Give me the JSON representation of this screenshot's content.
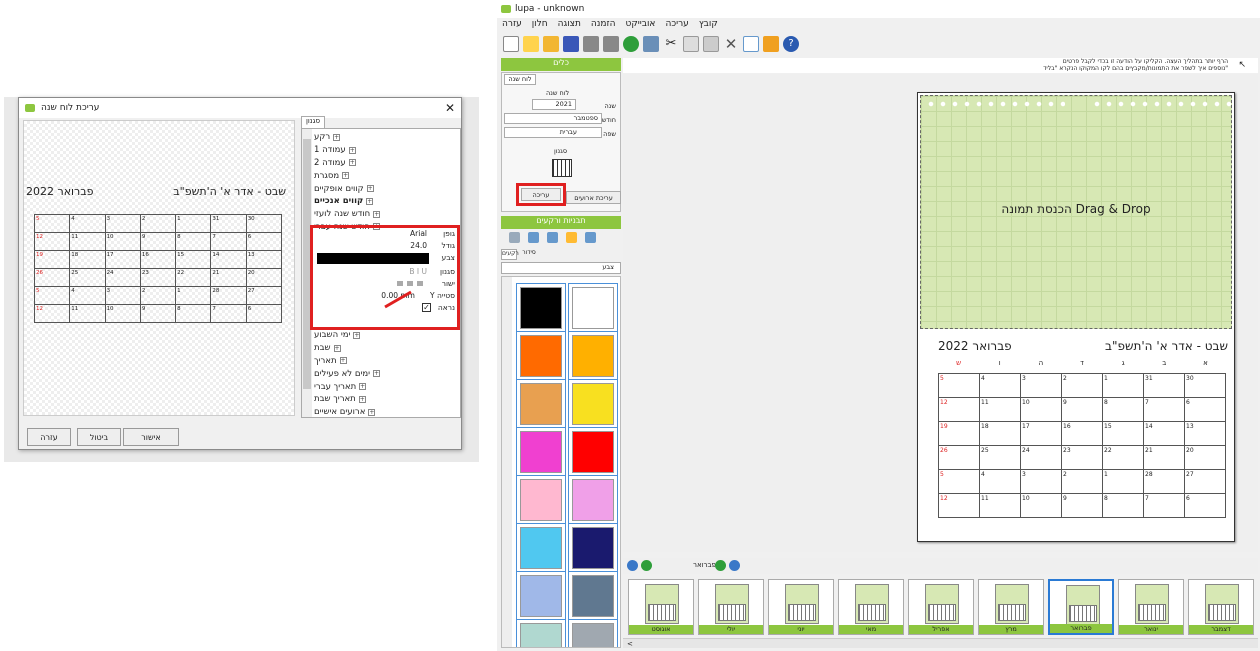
{
  "dialog": {
    "title": "עריכת לוח שנה",
    "tab": "סגנון",
    "preview_title_right": "שבט - אדר א' ה'תשפ\"ב",
    "preview_title_left": "פברואר 2022",
    "tree": [
      "רקע",
      "עמודה 1",
      "עמודה 2",
      "מסגרת",
      "קווים אופקיים",
      "קווים אנכיים",
      "חודש שנה לועזי",
      "חודש שנה עברי"
    ],
    "tree_after": [
      "ימי השבוע",
      "שבת",
      "תאריך",
      "ימים לא פעילים",
      "תאריך עברי",
      "תאריך שבת",
      "ארועים אישיים"
    ],
    "props": {
      "font_label": "גופן",
      "font_value": "Arial",
      "size_label": "גודל",
      "size_value": "24.0",
      "color_label": "צבע",
      "style_label": "סגנון",
      "style_value": "B  I  U",
      "align_label": "ישור",
      "offset_label": "Y סטייה",
      "offset_value": "0.00 mm",
      "visible_label": "נראה"
    },
    "buttons": {
      "ok": "אישור",
      "cancel": "ביטול",
      "help": "עזרה"
    }
  },
  "app": {
    "title": "lupa - unknown",
    "menu": [
      "קובץ",
      "עריכה",
      "אובייקט",
      "הזמנה",
      "תצוגה",
      "חלון",
      "עזרה"
    ],
    "tools_header": "כלים",
    "tools_tab": "לוח שנה",
    "cal_section": "לוח שנה",
    "year_label": "שנה",
    "year_value": "2021",
    "month_label": "חודש",
    "month_value": "ספטמבר",
    "lang_label": "שפה",
    "lang_value": "עברית",
    "style_label": "סגנון",
    "edit_events": "עריכת ארועים",
    "edit_button": "עריכה",
    "templates_header": "תבניות ורקעים",
    "templates_tabs": [
      "רקעים",
      "סידור"
    ],
    "colors_label": "צבע",
    "hint_line1": "הרף יותר בתהליך העצה. הקליקו על הודעה זו בכדי לקבל פרטים",
    "hint_line2": "נוספים איך לשפר את התמונות/מקבץים בהם לקו המקוקו הנקרא \"בליד\"",
    "dropzone": "הכנסת תמונה Drag & Drop",
    "page_title_right": "שבט - אדר א' ה'תשפ\"ב",
    "page_title_left": "פברואר 2022",
    "weekdays": [
      "א",
      "ב",
      "ג",
      "ד",
      "ה",
      "ו",
      "ש"
    ],
    "nav_month": "פברואר",
    "thumbs": [
      "דצמבר",
      "ינואר",
      "פברואר",
      "מרץ",
      "אפריל",
      "מאי",
      "יוני",
      "יולי",
      "אוגוסט"
    ]
  },
  "calendar_rows": [
    [
      "30",
      "31",
      "1",
      "2",
      "3",
      "4",
      "5"
    ],
    [
      "6",
      "7",
      "8",
      "9",
      "10",
      "11",
      "12"
    ],
    [
      "13",
      "14",
      "15",
      "16",
      "17",
      "18",
      "19"
    ],
    [
      "20",
      "21",
      "22",
      "23",
      "24",
      "25",
      "26"
    ],
    [
      "27",
      "28",
      "1",
      "2",
      "3",
      "4",
      "5"
    ],
    [
      "6",
      "7",
      "8",
      "9",
      "10",
      "11",
      "12"
    ]
  ],
  "swatch_colors": [
    "#000000",
    "#ffffff",
    "#ff6a00",
    "#ffb000",
    "#e8a050",
    "#f8e020",
    "#f040d0",
    "#ff0000",
    "#ffb8d0",
    "#f0a0e8",
    "#50c8f0",
    "#1a1a6e",
    "#a0b8e8",
    "#607890",
    "#b0d8d0",
    "#a0a8b0"
  ]
}
